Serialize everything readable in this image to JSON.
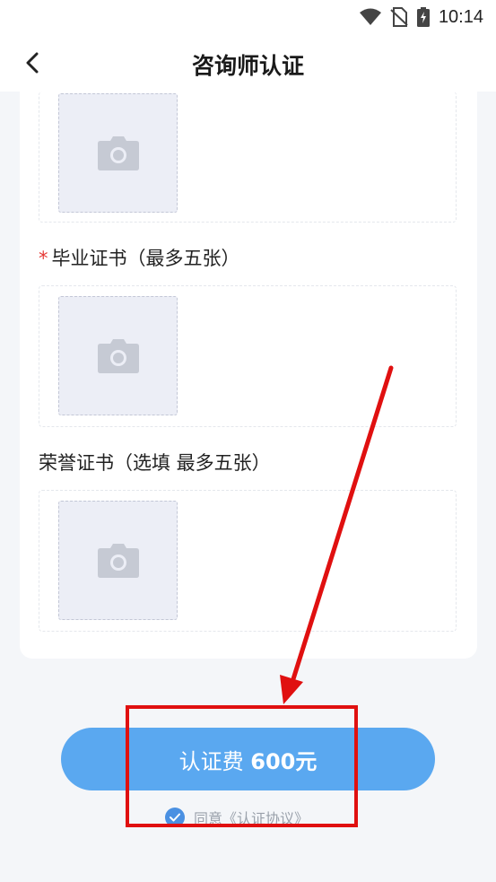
{
  "status_bar": {
    "time": "10:14"
  },
  "header": {
    "title": "咨询师认证"
  },
  "form": {
    "sections": [
      {
        "label": "毕业证书（最多五张）",
        "required": true,
        "required_mark": "*"
      },
      {
        "label": "荣誉证书（选填 最多五张）",
        "required": false
      }
    ]
  },
  "footer": {
    "pay_button_label": "认证费",
    "pay_button_amount": "600元",
    "agree_prefix": "同意",
    "agreement_link": "《认证协议》"
  },
  "colors": {
    "primary": "#5aa8f0",
    "check": "#4a90e2",
    "required": "#e53935",
    "annotation": "#e01010"
  },
  "icons": [
    "wifi-icon",
    "no-sim-icon",
    "battery-charging-icon",
    "back-arrow-icon",
    "camera-icon",
    "check-icon"
  ]
}
